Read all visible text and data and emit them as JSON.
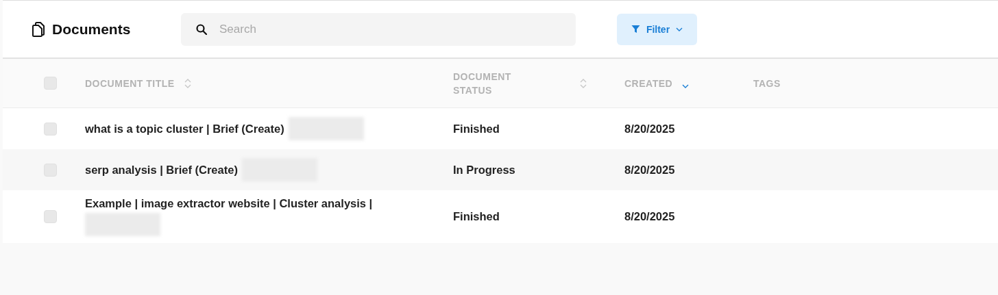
{
  "header": {
    "title": "Documents",
    "search": {
      "placeholder": "Search"
    },
    "filter_button": {
      "label": "Filter"
    }
  },
  "table": {
    "select_all": {
      "checked": false
    },
    "columns": [
      {
        "label": "DOCUMENT TITLE",
        "sortable": true,
        "sorted_descending": false
      },
      {
        "label": "DOCUMENT STATUS",
        "sortable": true,
        "sorted_descending": false
      },
      {
        "label": "CREATED",
        "sortable": true,
        "sorted_descending": true
      },
      {
        "label": "TAGS",
        "sortable": false
      }
    ],
    "rows": [
      {
        "checked": false,
        "title": "what is a topic cluster | Brief (Create)",
        "redacted": true,
        "status": "Finished",
        "created": "8/20/2025"
      },
      {
        "checked": false,
        "title": "serp analysis | Brief (Create)",
        "redacted": true,
        "status": "In Progress",
        "created": "8/20/2025"
      },
      {
        "checked": false,
        "title": "Example | image extractor website | Cluster analysis |",
        "redacted": true,
        "status": "Finished",
        "created": "8/20/2025"
      }
    ]
  }
}
